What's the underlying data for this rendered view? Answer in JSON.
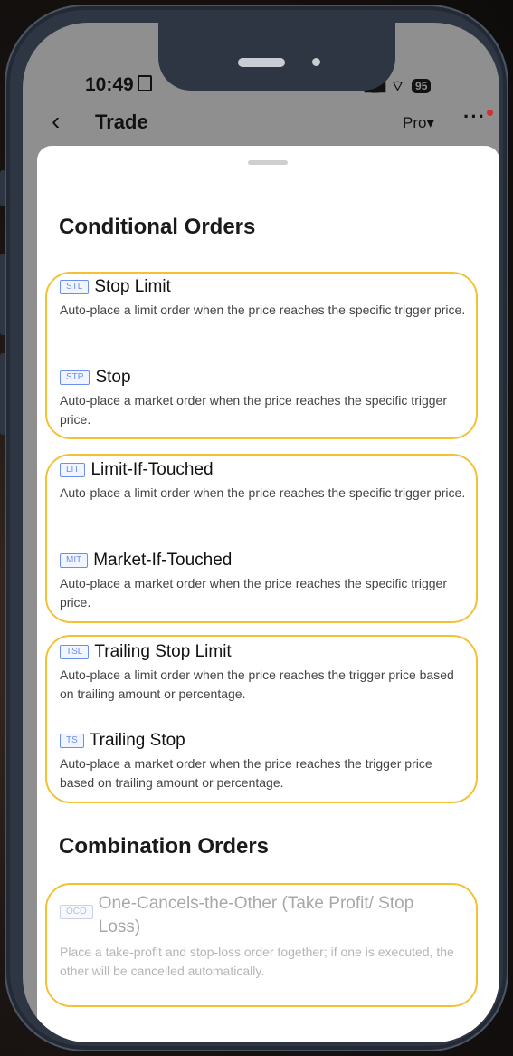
{
  "status_bar": {
    "time": "10:49",
    "signal": "▂▄▆",
    "wifi": "⌔",
    "battery": "95"
  },
  "header": {
    "back_icon": "‹",
    "title": "Trade",
    "pro_label": "Pro▾",
    "more_icon": "···"
  },
  "conditional": {
    "title": "Conditional Orders",
    "groups": [
      {
        "items": [
          {
            "tag": "STL",
            "name": "Stop Limit",
            "desc": "Auto-place a limit order when the price reaches the specific trigger price."
          },
          {
            "tag": "STP",
            "name": "Stop",
            "desc": "Auto-place a market order when the price reaches the specific trigger price."
          }
        ]
      },
      {
        "items": [
          {
            "tag": "LIT",
            "name": "Limit-If-Touched",
            "desc": "Auto-place a limit order when the price reaches the specific trigger price."
          },
          {
            "tag": "MIT",
            "name": "Market-If-Touched",
            "desc": "Auto-place a market order when the price reaches the specific trigger price."
          }
        ]
      },
      {
        "items": [
          {
            "tag": "TSL",
            "name": "Trailing Stop Limit",
            "desc": "Auto-place a limit order when the price reaches the trigger price based on trailing amount or percentage."
          },
          {
            "tag": "TS",
            "name": "Trailing Stop",
            "desc": "Auto-place a market order when the price reaches the trigger price based on trailing amount or percentage."
          }
        ]
      }
    ]
  },
  "combination": {
    "title": "Combination Orders",
    "items": [
      {
        "tag": "OCO",
        "name": "One-Cancels-the-Other (Take Profit/ Stop Loss)",
        "desc": "Place a take-profit and stop-loss order together; if one is executed, the other will be cancelled automatically."
      }
    ]
  },
  "colors": {
    "highlight": "#f2c232",
    "tag_blue": "#6b8ff0"
  }
}
